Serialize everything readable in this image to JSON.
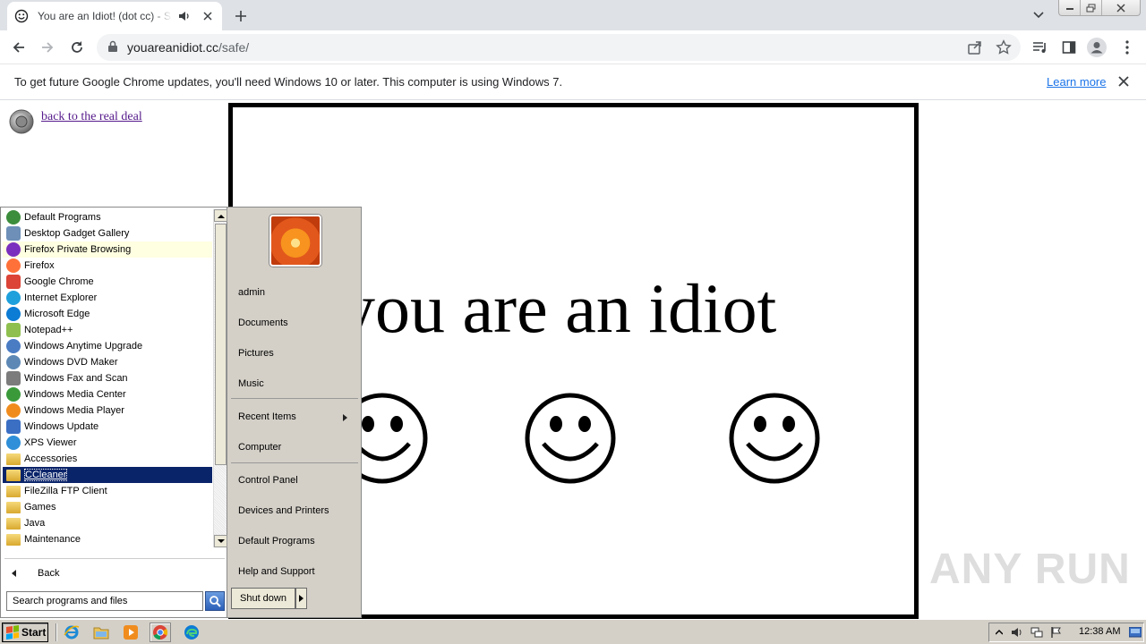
{
  "browser": {
    "tab": {
      "title": "You are an Idiot! (dot cc) - Safe",
      "favicon": "smiley-icon",
      "audio_icon": "speaker-icon"
    },
    "new_tab_icon": "plus-icon",
    "omnibox": {
      "domain": "youareanidiot.cc",
      "path": "/safe/"
    }
  },
  "infobar": {
    "message": "To get future Google Chrome updates, you'll need Windows 10 or later. This computer is using Windows 7.",
    "link": "Learn more"
  },
  "page": {
    "back_link": "back to the real deal",
    "banner_text": "you are an idiot",
    "watermark": "ANY RUN"
  },
  "start_menu": {
    "programs": [
      {
        "label": "Default Programs",
        "color": "#3c8d3c"
      },
      {
        "label": "Desktop Gadget Gallery",
        "color": "#6d8fb8"
      },
      {
        "label": "Firefox Private Browsing",
        "color": "#7b2fbe",
        "highlight": true
      },
      {
        "label": "Firefox",
        "color": "#ff7139"
      },
      {
        "label": "Google Chrome",
        "color": "#db4437"
      },
      {
        "label": "Internet Explorer",
        "color": "#1ea0dc"
      },
      {
        "label": "Microsoft Edge",
        "color": "#0c7cd5"
      },
      {
        "label": "Notepad++",
        "color": "#8fc04f"
      },
      {
        "label": "Windows Anytime Upgrade",
        "color": "#4a7cc3"
      },
      {
        "label": "Windows DVD Maker",
        "color": "#5d88b5"
      },
      {
        "label": "Windows Fax and Scan",
        "color": "#7c7c7c"
      },
      {
        "label": "Windows Media Center",
        "color": "#3a9a3a"
      },
      {
        "label": "Windows Media Player",
        "color": "#f08c1e"
      },
      {
        "label": "Windows Update",
        "color": "#3b6fc4"
      },
      {
        "label": "XPS Viewer",
        "color": "#2f8fd8"
      },
      {
        "label": "Accessories",
        "folder": true
      },
      {
        "label": "CCleaner",
        "folder": true,
        "selected": true
      },
      {
        "label": "FileZilla FTP Client",
        "folder": true
      },
      {
        "label": "Games",
        "folder": true
      },
      {
        "label": "Java",
        "folder": true
      },
      {
        "label": "Maintenance",
        "folder": true
      }
    ],
    "back_label": "Back",
    "search_placeholder": "Search programs and files",
    "right_items": {
      "user": "admin",
      "documents": "Documents",
      "pictures": "Pictures",
      "music": "Music",
      "recent": "Recent Items",
      "computer": "Computer",
      "control_panel": "Control Panel",
      "devices": "Devices and Printers",
      "default_programs": "Default Programs",
      "help": "Help and Support"
    },
    "shutdown_label": "Shut down"
  },
  "taskbar": {
    "start_label": "Start",
    "clock": "12:38 AM",
    "quick_launch": [
      "ie-icon",
      "explorer-icon",
      "media-player-icon",
      "chrome-icon",
      "edge-icon"
    ]
  }
}
